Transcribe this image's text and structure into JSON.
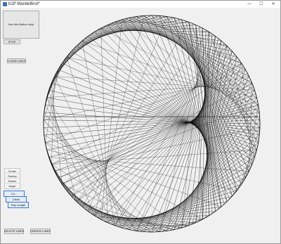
{
  "window": {
    "title": "b1P Mandelbrot*",
    "controls": [
      "—",
      "☐",
      "✕"
    ]
  },
  "left_controls": {
    "big_button_label": "Use this Button only!",
    "stop_label": "STOP",
    "clear_lines_label": "CLEAR LINES"
  },
  "param_panel": {
    "rows": [
      "Center",
      "Radius",
      "Divisio",
      "Angle"
    ]
  },
  "stacked_buttons": [
    "Co...",
    "Circle",
    "Ray Length"
  ],
  "bottom_buttons": {
    "delete_label": "DELETE LINES",
    "create_label": "CREATE LINES"
  },
  "icons": {
    "app": "app-icon",
    "minimize": "minimize-icon",
    "maximize": "maximize-icon",
    "close": "close-icon"
  }
}
